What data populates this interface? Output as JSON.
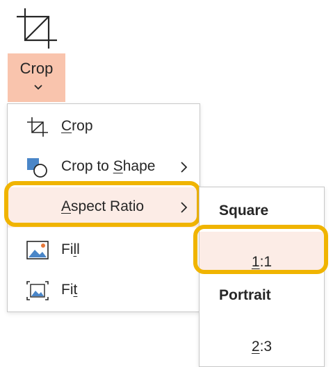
{
  "ribbon": {
    "crop_button": {
      "label": "Crop",
      "icon": "crop-icon",
      "dropdown_icon": "chevron-down-icon"
    },
    "accent": "#f9c4ad"
  },
  "menu": {
    "items": [
      {
        "id": "crop",
        "label_pre": "",
        "label_key": "C",
        "label_post": "rop",
        "icon": "crop-icon",
        "submenu": false
      },
      {
        "id": "crop-to-shape",
        "label_pre": "Crop to ",
        "label_key": "S",
        "label_post": "hape",
        "icon": "crop-to-shape-icon",
        "submenu": true
      },
      {
        "id": "aspect-ratio",
        "label_pre": "",
        "label_key": "A",
        "label_post": "spect Ratio",
        "icon": "",
        "submenu": true,
        "highlighted": true
      },
      {
        "id": "fill",
        "label_pre": "Fi",
        "label_key": "l",
        "label_post": "l",
        "icon": "fill-picture-icon",
        "submenu": false
      },
      {
        "id": "fit",
        "label_pre": "Fi",
        "label_key": "t",
        "label_post": "",
        "icon": "fit-picture-icon",
        "submenu": false
      }
    ],
    "highlight_color": "#fcece6",
    "callout_color": "#f0b400"
  },
  "aspect_submenu": {
    "groups": [
      {
        "header": "Square",
        "items": [
          {
            "key": "1",
            "rest": ":1",
            "highlighted": true
          }
        ]
      },
      {
        "header": "Portrait",
        "items": [
          {
            "key": "2",
            "rest": ":3",
            "highlighted": false
          }
        ]
      }
    ]
  }
}
